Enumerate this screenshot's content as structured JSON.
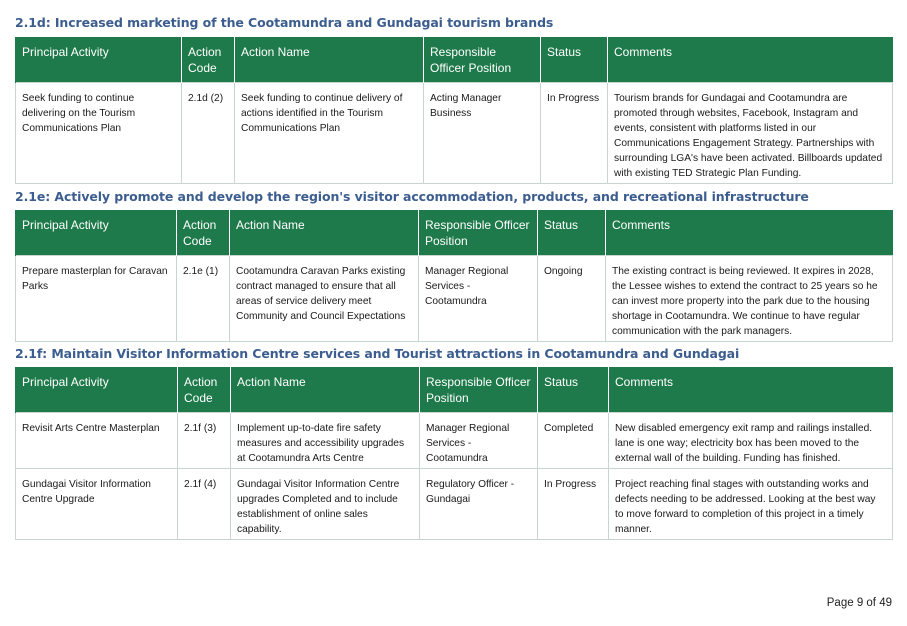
{
  "headers": {
    "activity": "Principal Activity",
    "code": "Action Code",
    "name": "Action Name",
    "officer": "Responsible Officer Position",
    "status": "Status",
    "comments": "Comments"
  },
  "sections": [
    {
      "title": "2.1d: Increased marketing of the Cootamundra and Gundagai tourism brands",
      "rows": [
        {
          "activity": "Seek funding to continue delivering on the Tourism Communications Plan",
          "code": "2.1d (2)",
          "name": "Seek funding to continue delivery of actions identified in the Tourism Communications Plan",
          "officer": "Acting Manager Business",
          "status": "In Progress",
          "comments": "Tourism brands for Gundagai and Cootamundra are promoted through websites, Facebook, Instagram and events, consistent with platforms listed in our Communications Engagement Strategy. Partnerships with surrounding LGA's have been activated. Billboards updated with existing TED Strategic Plan Funding."
        }
      ]
    },
    {
      "title": "2.1e: Actively promote and develop the region's visitor accommodation, products, and recreational infrastructure",
      "rows": [
        {
          "activity": "Prepare masterplan for Caravan Parks",
          "code": "2.1e (1)",
          "name": "Cootamundra Caravan Parks existing contract managed to ensure that all areas of service delivery meet Community and Council Expectations",
          "officer": "Manager Regional Services - Cootamundra",
          "status": "Ongoing",
          "comments": "The existing contract is being reviewed. It expires in 2028, the Lessee wishes to extend the contract to 25 years so he can invest more property into the park due to the housing shortage in Cootamundra. We continue to have regular communication with the park managers."
        }
      ]
    },
    {
      "title": "2.1f: Maintain Visitor Information Centre services and Tourist attractions in Cootamundra and Gundagai",
      "rows": [
        {
          "activity": "Revisit Arts Centre Masterplan",
          "code": "2.1f (3)",
          "name": "Implement up-to-date fire safety measures and accessibility upgrades at Cootamundra Arts Centre",
          "officer": "Manager Regional Services - Cootamundra",
          "status": "Completed",
          "comments": "New disabled emergency exit ramp and railings installed. lane is one way; electricity box has been moved to the external wall of the building. Funding has finished."
        },
        {
          "activity": "Gundagai Visitor Information Centre Upgrade",
          "code": "2.1f (4)",
          "name": "Gundagai Visitor Information Centre upgrades Completed and to include establishment of online sales capability.",
          "officer": "Regulatory Officer - Gundagai",
          "status": "In Progress",
          "comments": "Project reaching final stages with outstanding works and defects needing to be addressed. Looking at the best way to move forward to completion of this project in a timely manner."
        }
      ]
    }
  ],
  "footer": {
    "page": "Page 9 of 49"
  }
}
